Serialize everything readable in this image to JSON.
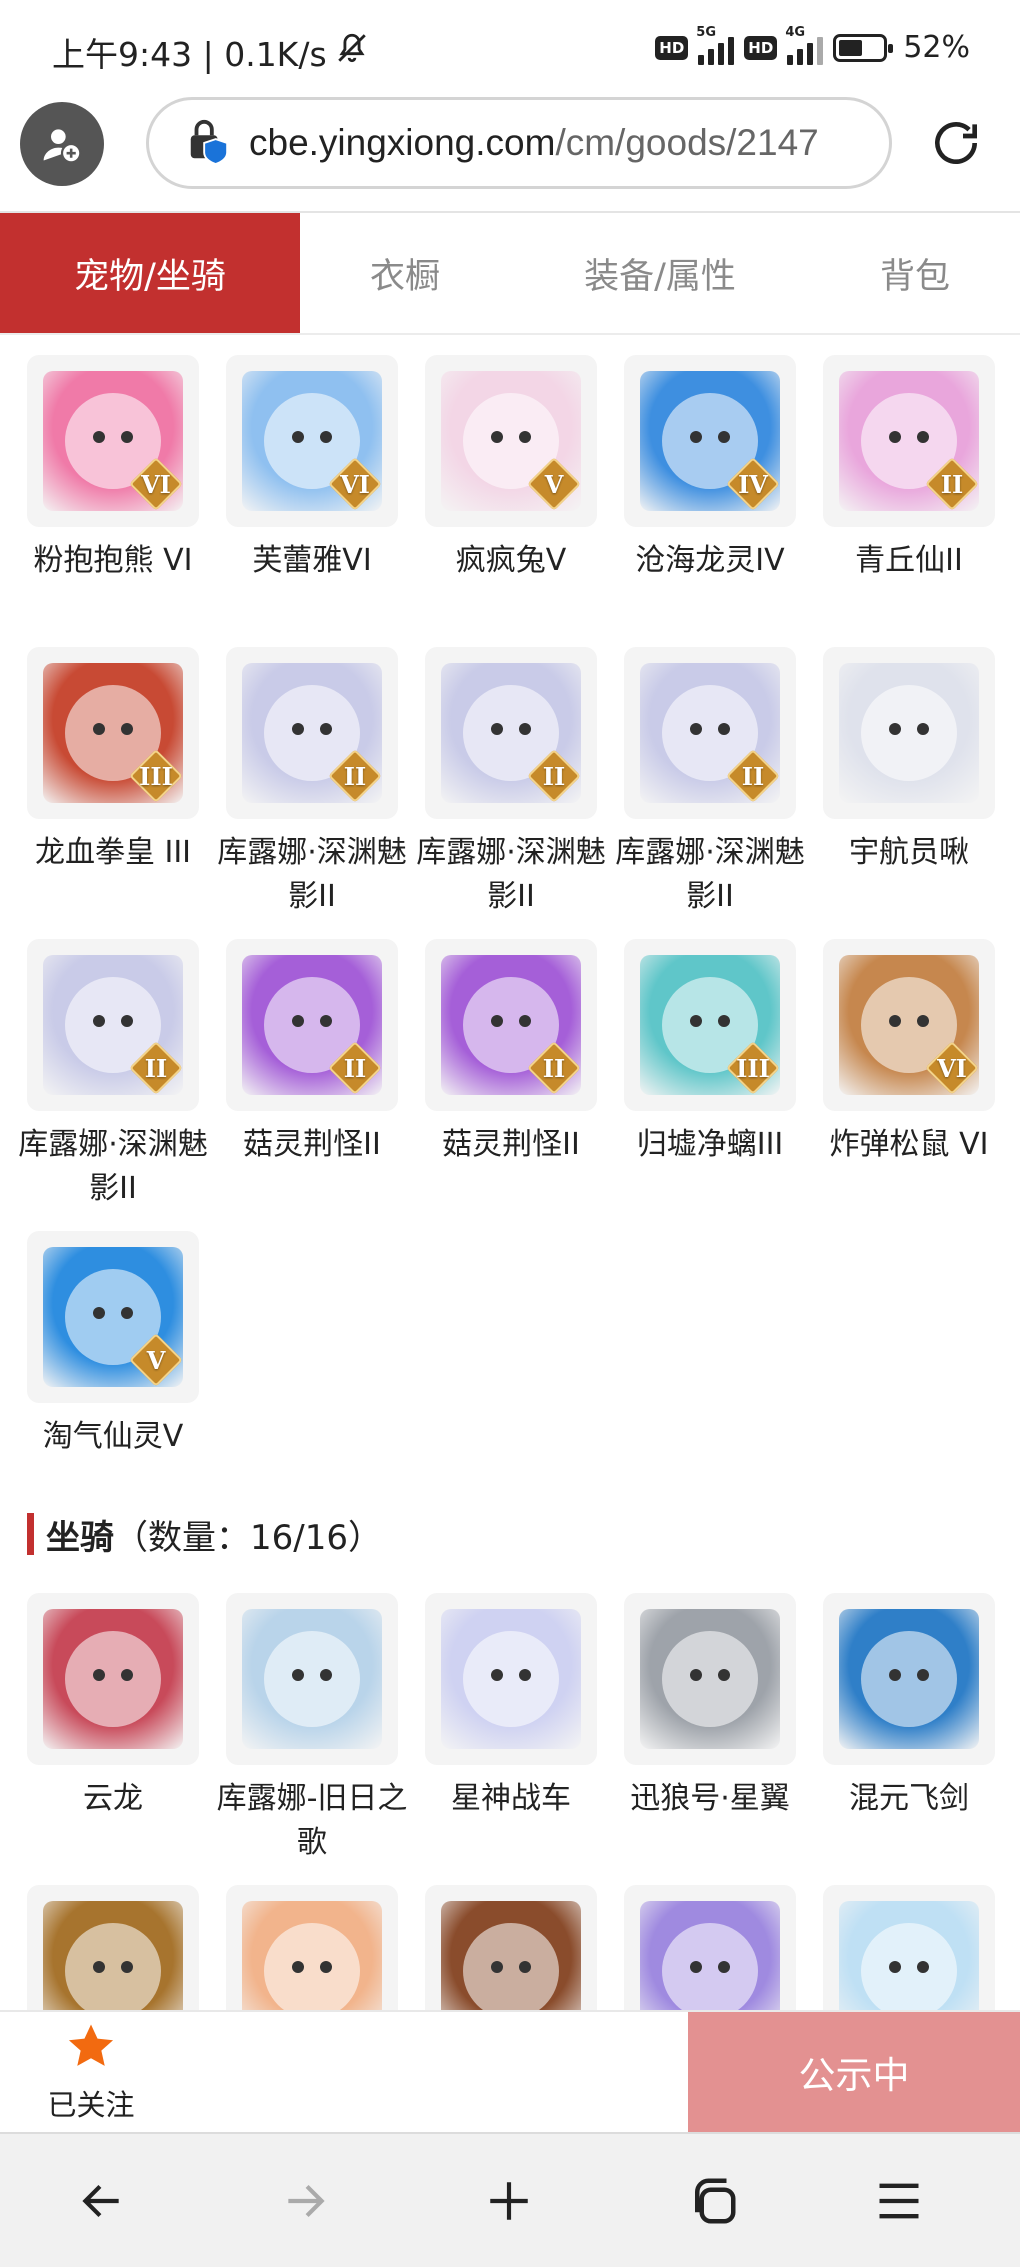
{
  "status_bar": {
    "time_speed": "上午9:43 | 0.1K/s",
    "hd1": "HD",
    "gen1": "5G",
    "hd2": "HD",
    "gen2": "4G",
    "battery_percent": "52%",
    "battery_level": 0.52,
    "mute_icon": "bell-off-icon"
  },
  "address_bar": {
    "url_host": "cbe.yingxiong.com",
    "url_path": "/cm/goods/2147",
    "profile_icon": "profile-add-icon",
    "lock_icon": "lock-shield-icon",
    "reload_icon": "reload-icon"
  },
  "tabs": [
    {
      "label": "宠物/坐骑",
      "active": true
    },
    {
      "label": "衣橱",
      "active": false
    },
    {
      "label": "装备/属性",
      "active": false
    },
    {
      "label": "背包",
      "active": false
    }
  ],
  "pets": [
    {
      "name": "粉抱抱熊 VI",
      "badge": "VI",
      "color": "#f07aa8"
    },
    {
      "name": "芙蕾雅VI",
      "badge": "VI",
      "color": "#8fc0f0"
    },
    {
      "name": "疯疯兔V",
      "badge": "V",
      "color": "#f3d6e6"
    },
    {
      "name": "沧海龙灵IV",
      "badge": "IV",
      "color": "#3e8fe0"
    },
    {
      "name": "青丘仙II",
      "badge": "II",
      "color": "#e9a6dc"
    },
    {
      "name": "龙血拳皇 III",
      "badge": "III",
      "color": "#c84a34"
    },
    {
      "name": "库露娜·深渊魅影II",
      "badge": "II",
      "color": "#c9cbe8"
    },
    {
      "name": "库露娜·深渊魅影II",
      "badge": "II",
      "color": "#c9cbe8"
    },
    {
      "name": "库露娜·深渊魅影II",
      "badge": "II",
      "color": "#c9cbe8"
    },
    {
      "name": "宇航员啾",
      "badge": "",
      "color": "#dfe2ec"
    },
    {
      "name": "库露娜·深渊魅影II",
      "badge": "II",
      "color": "#c9cbe8"
    },
    {
      "name": "菇灵荆怪II",
      "badge": "II",
      "color": "#a55fd8"
    },
    {
      "name": "菇灵荆怪II",
      "badge": "II",
      "color": "#a55fd8"
    },
    {
      "name": "归墟净螭III",
      "badge": "III",
      "color": "#5fc6c9"
    },
    {
      "name": "炸弹松鼠 VI",
      "badge": "VI",
      "color": "#c6874e"
    },
    {
      "name": "淘气仙灵V",
      "badge": "V",
      "color": "#2e8ee0"
    }
  ],
  "mount_section": {
    "title": "坐骑",
    "count": "（数量：16/16）"
  },
  "mounts": [
    {
      "name": "云龙",
      "badge": "",
      "color": "#c84a5a"
    },
    {
      "name": "库露娜-旧日之歌",
      "badge": "",
      "color": "#b9d4ea"
    },
    {
      "name": "星神战车",
      "badge": "",
      "color": "#cfd2f2"
    },
    {
      "name": "迅狼号·星翼",
      "badge": "",
      "color": "#9ea3aa"
    },
    {
      "name": "混元飞剑",
      "badge": "",
      "color": "#2f7fc8"
    },
    {
      "name": "",
      "badge": "",
      "color": "#a7742e"
    },
    {
      "name": "",
      "badge": "",
      "color": "#f2b48c"
    },
    {
      "name": "",
      "badge": "",
      "color": "#8a4c2c"
    },
    {
      "name": "",
      "badge": "",
      "color": "#9f8ae0"
    },
    {
      "name": "",
      "badge": "",
      "color": "#bfe0f4"
    }
  ],
  "action_bar": {
    "follow_label": "已关注",
    "star_icon": "star-icon",
    "notice_label": "公示中"
  },
  "navbar": {
    "icons": [
      "back-arrow-icon",
      "forward-arrow-icon",
      "new-tab-plus-icon",
      "tabs-icon",
      "menu-icon"
    ]
  }
}
